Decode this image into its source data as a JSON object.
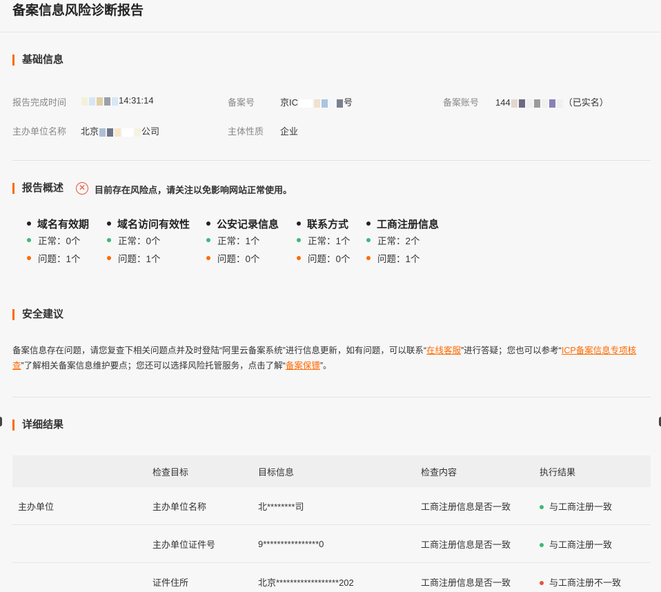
{
  "header": {
    "title": "备案信息风险诊断报告"
  },
  "basic": {
    "title": "基础信息",
    "report_time_label": "报告完成时间",
    "report_time_value": "14:31:14",
    "record_no_label": "备案号",
    "record_no_prefix": "京IC",
    "record_no_suffix": "号",
    "account_label": "备案账号",
    "account_prefix": "144",
    "account_suffix": "（已实名）",
    "org_name_label": "主办单位名称",
    "org_name_prefix": "北京",
    "org_name_suffix": "公司",
    "entity_label": "主体性质",
    "entity_value": "企业"
  },
  "overview": {
    "title": "报告概述",
    "message": "目前存在风险点，请关注以免影响网站正常使用。",
    "stats": [
      {
        "title": "域名有效期",
        "normal": "正常：0个",
        "issue": "问题：1个"
      },
      {
        "title": "域名访问有效性",
        "normal": "正常：0个",
        "issue": "问题：1个"
      },
      {
        "title": "公安记录信息",
        "normal": "正常：1个",
        "issue": "问题：0个"
      },
      {
        "title": "联系方式",
        "normal": "正常：1个",
        "issue": "问题：0个"
      },
      {
        "title": "工商注册信息",
        "normal": "正常：2个",
        "issue": "问题：1个"
      }
    ]
  },
  "advice": {
    "title": "安全建议",
    "text1": "备案信息存在问题，请您复查下相关问题点并及时登陆“阿里云备案系统”进行信息更新，如有问题，可以联系“",
    "link1": "在线客服",
    "text2": "”进行答疑；您也可以参考“",
    "link2": "ICP备案信息专项核查",
    "text3": "”了解相关备案信息维护要点；您还可以选择风险托管服务，点击了解“",
    "link3": "备案保镖",
    "text4": "”。"
  },
  "details": {
    "title": "详细结果",
    "columns": [
      "检查目标",
      "目标信息",
      "检查内容",
      "执行结果"
    ],
    "rows": [
      {
        "group": "主办单位",
        "target": "主办单位名称",
        "info": "北********司",
        "content": "工商注册信息是否一致",
        "result": "与工商注册一致",
        "ok": true
      },
      {
        "group": "",
        "target": "主办单位证件号",
        "info": "9****************0",
        "content": "工商注册信息是否一致",
        "result": "与工商注册一致",
        "ok": true
      },
      {
        "group": "",
        "target": "证件住所",
        "info": "北京******************202",
        "content": "工商注册信息是否一致",
        "result": "与工商注册不一致",
        "ok": false
      }
    ]
  },
  "colors": {
    "accent": "#ff6a00",
    "ok": "#3cb878",
    "error": "#e5533b"
  }
}
